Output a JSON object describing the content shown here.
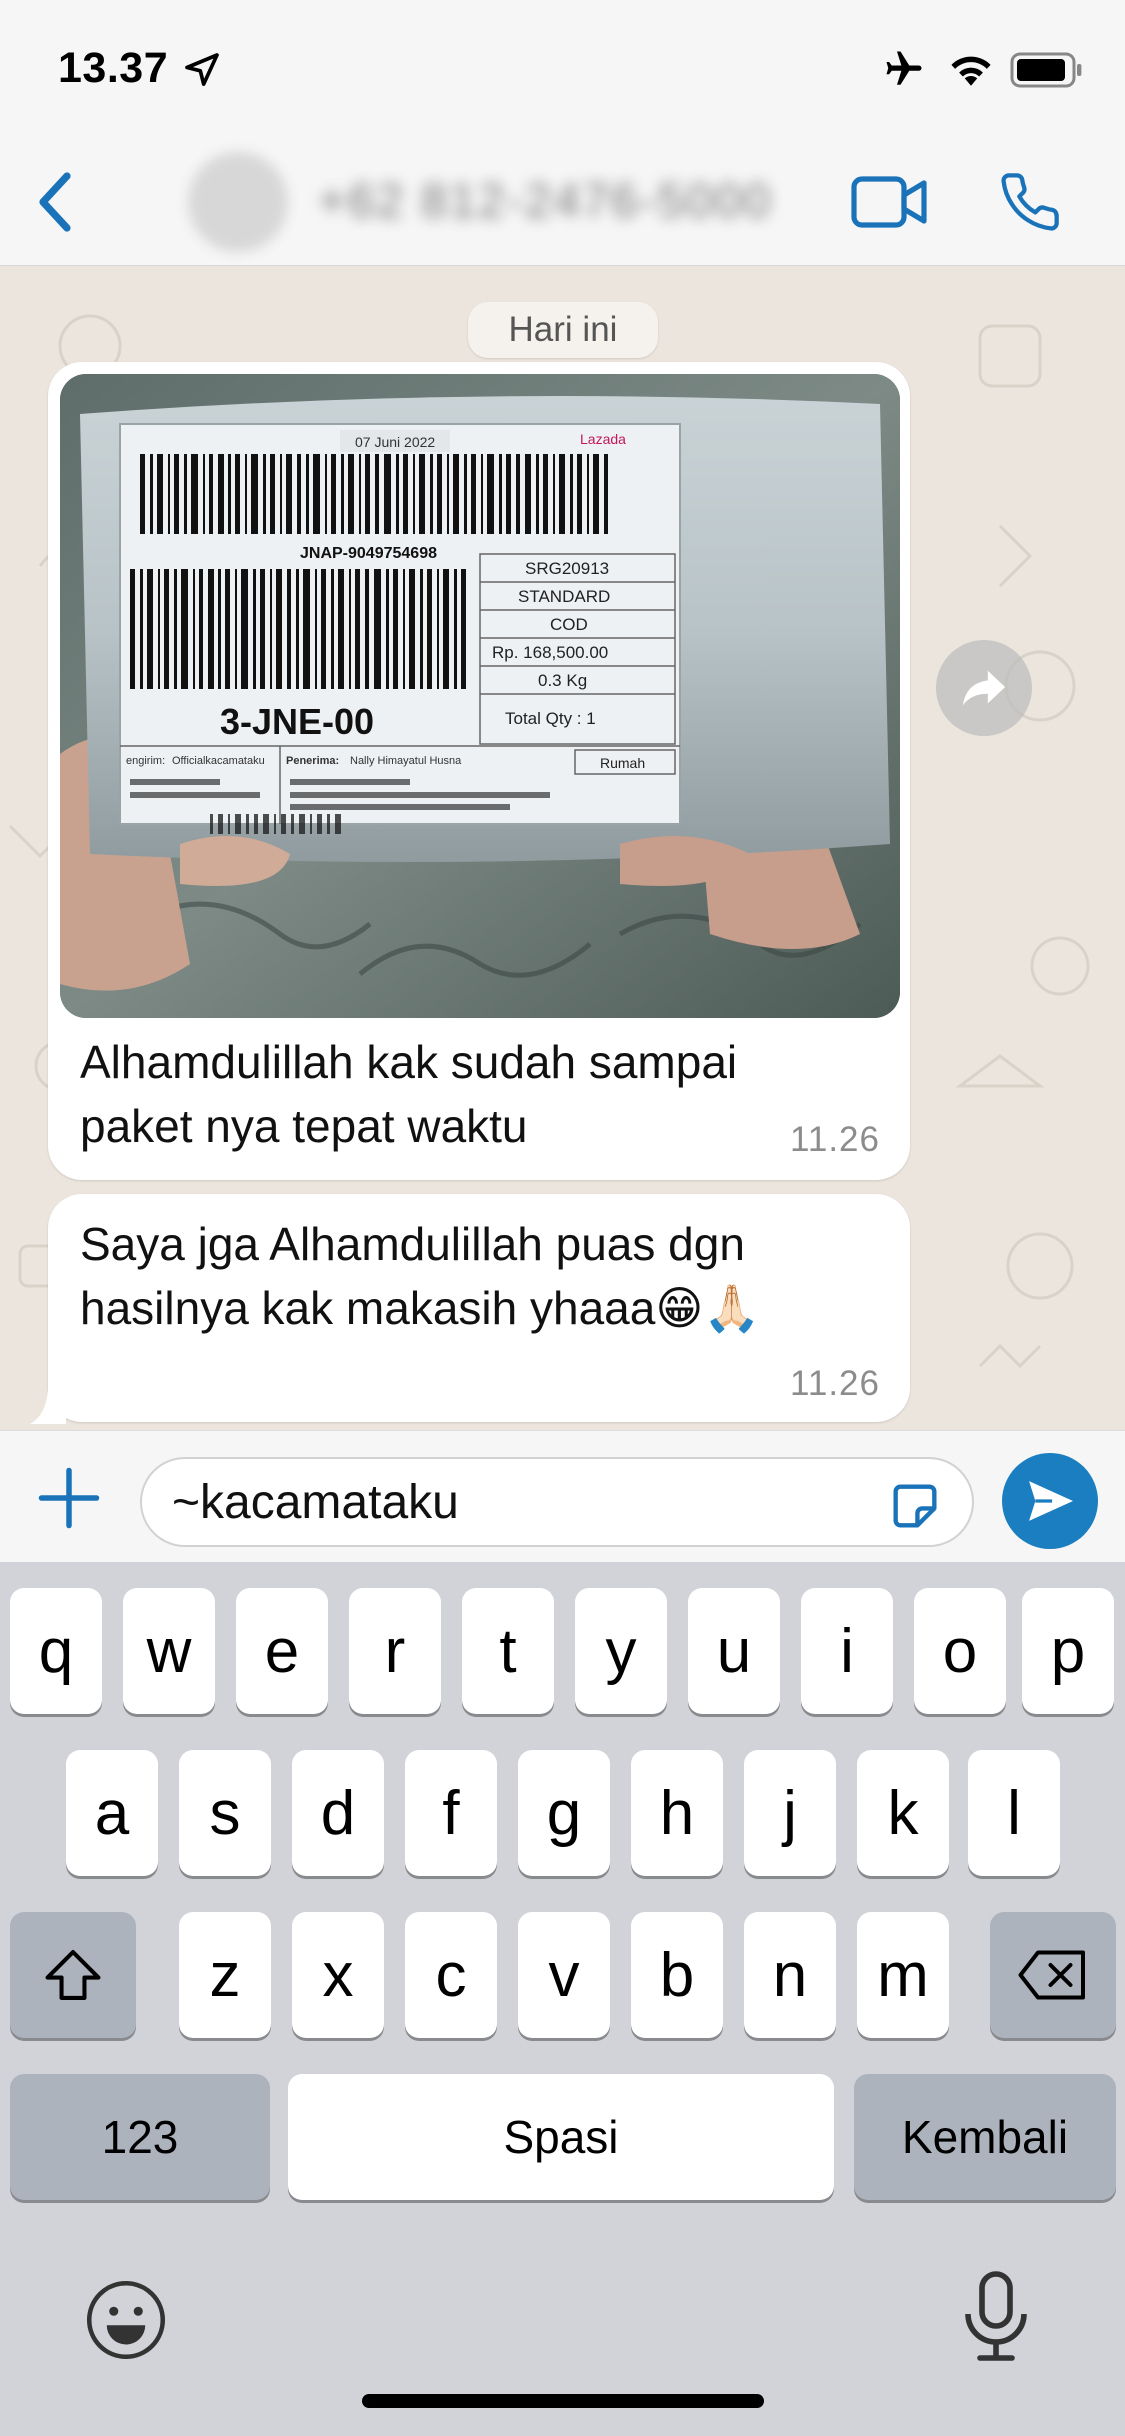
{
  "status_bar": {
    "time": "13.37",
    "icons": [
      "location-arrow-icon",
      "airplane-icon",
      "wifi-icon",
      "battery-icon"
    ]
  },
  "nav": {
    "contact_name": "+62 812-2476-5000",
    "back_icon": "chevron-left-icon",
    "video_icon": "video-camera-icon",
    "call_icon": "phone-icon",
    "accent_color": "#1a73b8"
  },
  "chat": {
    "date_separator": "Hari ini",
    "messages": [
      {
        "type": "image",
        "photo_label": {
          "tracking": "JNAP-9049754698",
          "route_code": "3-JNE-00",
          "order_code": "SRG20913",
          "service": "STANDARD",
          "payment": "COD",
          "price": "Rp. 168,500.00",
          "weight": "0.3 Kg",
          "total_qty": "Total Qty : 1",
          "address_type": "Rumah",
          "date": "07 Juni 2022",
          "brand": "Lazada",
          "sender_label": "engirim:",
          "sender_name": "Officialkacamataku",
          "recipient_label": "Penerima:",
          "recipient_name": "Nally Himayatul Husna"
        },
        "text": "Alhamdulillah kak sudah sampai paket nya tepat waktu",
        "time": "11.26"
      },
      {
        "type": "text",
        "text": "Saya jga Alhamdulillah puas dgn hasilnya kak makasih yhaaa😁🙏🏻",
        "time": "11.26"
      }
    ],
    "forward_icon": "forward-arrow-icon"
  },
  "input": {
    "value": "~kacamataku",
    "plus_icon": "plus-icon",
    "sticker_icon": "sticker-icon",
    "send_icon": "send-icon"
  },
  "keyboard": {
    "row1": [
      "q",
      "w",
      "e",
      "r",
      "t",
      "y",
      "u",
      "i",
      "o",
      "p"
    ],
    "row2": [
      "a",
      "s",
      "d",
      "f",
      "g",
      "h",
      "j",
      "k",
      "l"
    ],
    "row3": [
      "z",
      "x",
      "c",
      "v",
      "b",
      "n",
      "m"
    ],
    "numbers_key": "123",
    "space_key": "Spasi",
    "return_key": "Kembali",
    "shift_icon": "shift-icon",
    "delete_icon": "backspace-icon",
    "emoji_icon": "emoji-icon",
    "mic_icon": "microphone-icon"
  }
}
